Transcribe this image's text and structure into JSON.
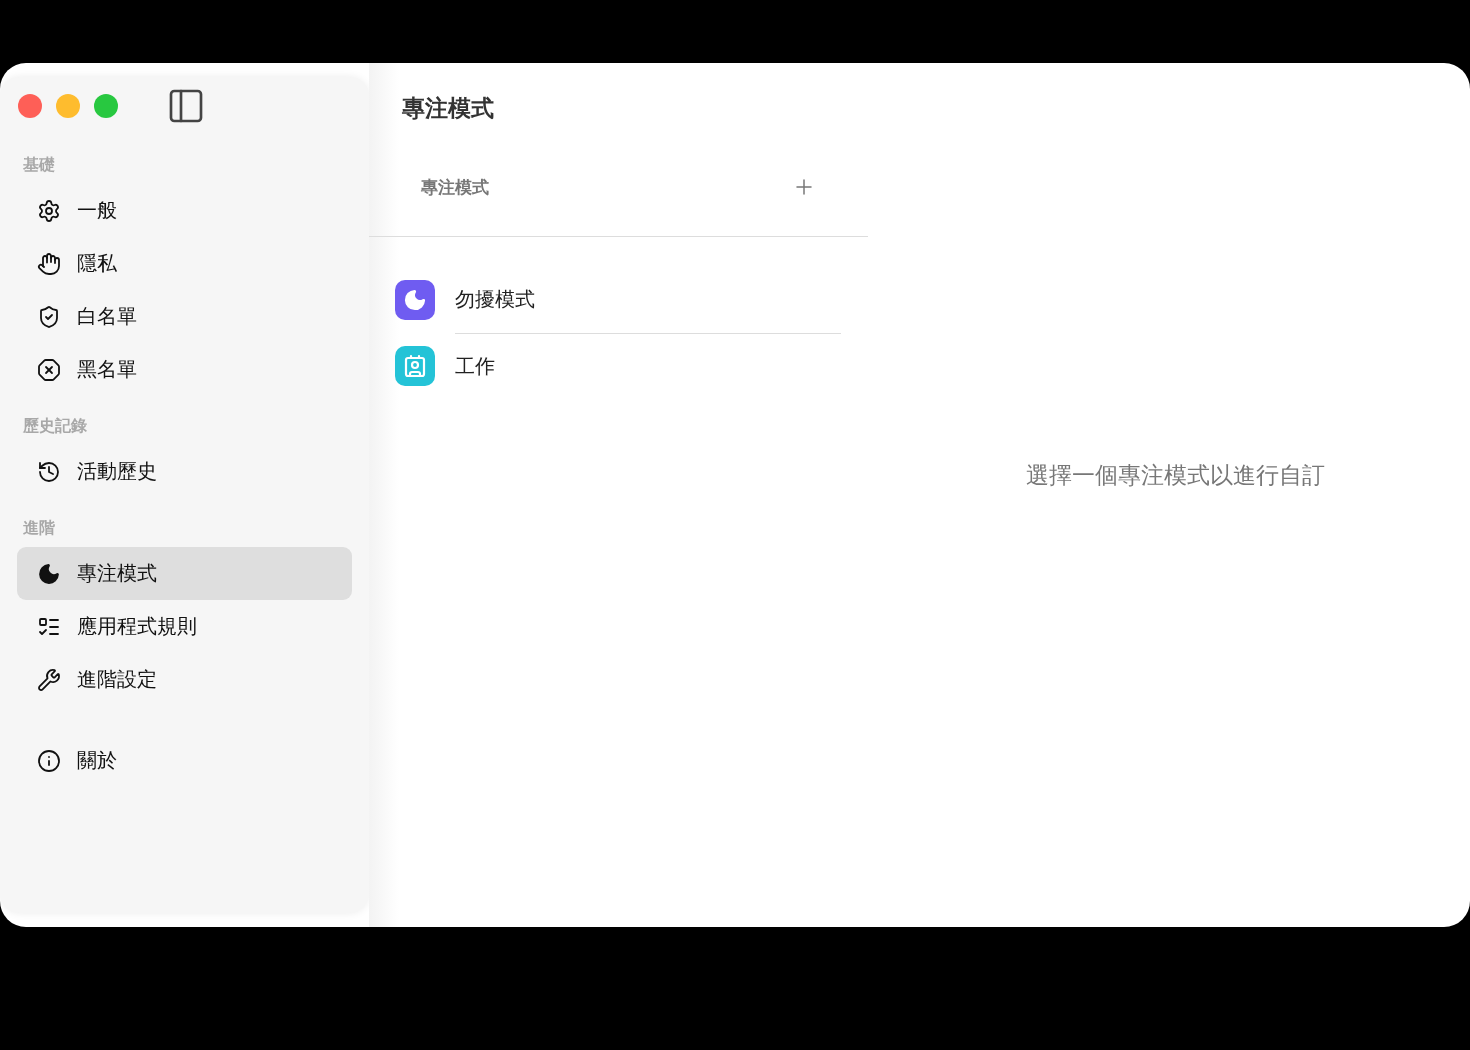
{
  "sidebar": {
    "sections": [
      {
        "title": "基礎",
        "items": [
          {
            "label": "一般",
            "selected": false
          },
          {
            "label": "隱私",
            "selected": false
          },
          {
            "label": "白名單",
            "selected": false
          },
          {
            "label": "黑名單",
            "selected": false
          }
        ]
      },
      {
        "title": "歷史記錄",
        "items": [
          {
            "label": "活動歷史",
            "selected": false
          }
        ]
      },
      {
        "title": "進階",
        "items": [
          {
            "label": "專注模式",
            "selected": true
          },
          {
            "label": "應用程式規則",
            "selected": false
          },
          {
            "label": "進階設定",
            "selected": false
          }
        ]
      },
      {
        "items": [
          {
            "label": "關於",
            "selected": false
          }
        ]
      }
    ]
  },
  "header": {
    "title": "專注模式"
  },
  "focus_list": {
    "heading": "專注模式",
    "modes": [
      {
        "label": "勿擾模式",
        "color": "#6f5cf1"
      },
      {
        "label": "工作",
        "color": "#24c3d7"
      }
    ]
  },
  "detail": {
    "empty_message": "選擇一個專注模式以進行自訂"
  }
}
